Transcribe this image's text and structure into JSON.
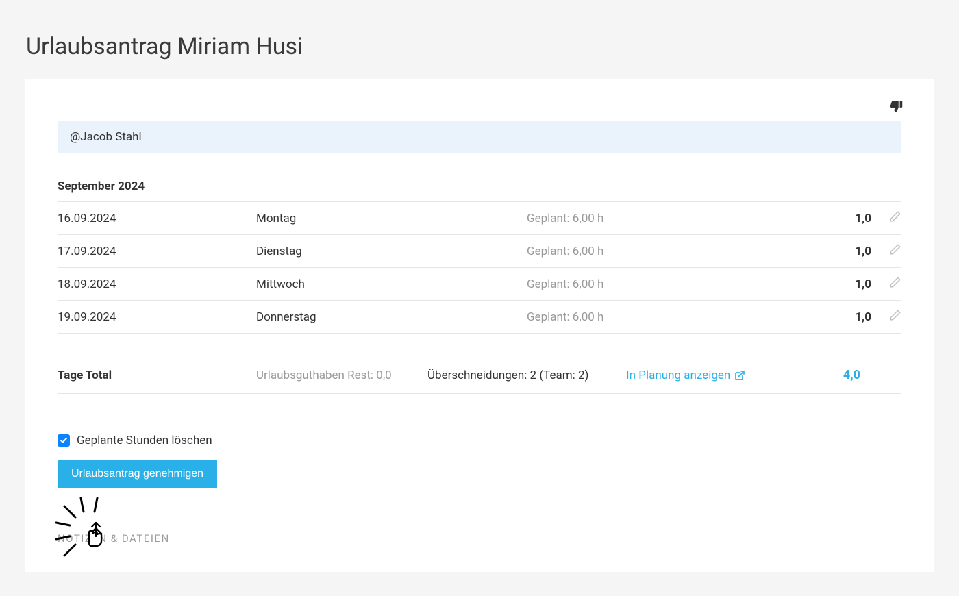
{
  "pageTitle": "Urlaubsantrag Miriam Husi",
  "mention": "@Jacob Stahl",
  "monthHeader": "September 2024",
  "days": [
    {
      "date": "16.09.2024",
      "weekday": "Montag",
      "planned": "Geplant: 6,00 h",
      "value": "1,0"
    },
    {
      "date": "17.09.2024",
      "weekday": "Dienstag",
      "planned": "Geplant: 6,00 h",
      "value": "1,0"
    },
    {
      "date": "18.09.2024",
      "weekday": "Mittwoch",
      "planned": "Geplant: 6,00 h",
      "value": "1,0"
    },
    {
      "date": "19.09.2024",
      "weekday": "Donnerstag",
      "planned": "Geplant: 6,00 h",
      "value": "1,0"
    }
  ],
  "totals": {
    "label": "Tage Total",
    "rest": "Urlaubsguthaben Rest: 0,0",
    "overlap": "Überschneidungen: 2 (Team: 2)",
    "planningLink": "In Planung anzeigen",
    "total": "4,0"
  },
  "checkboxLabel": "Geplante Stunden löschen",
  "approveButton": "Urlaubsantrag genehmigen",
  "notesHeader": "NOTIZEN & DATEIEN"
}
